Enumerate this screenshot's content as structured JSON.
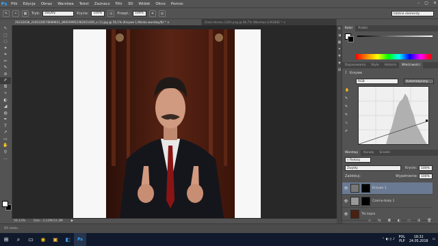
{
  "menubar": {
    "logo": "Ps",
    "items": [
      "Plik",
      "Edycja",
      "Obraz",
      "Warstwa",
      "Tekst",
      "Zaznacz",
      "Filtr",
      "3D",
      "Widok",
      "Okno",
      "Pomoc"
    ],
    "window_controls": [
      "–",
      "▢",
      "✕"
    ]
  },
  "options_bar": {
    "mode_label": "Tryb:",
    "mode_value": "Zwykły",
    "opacity_label": "Krycie:",
    "opacity_value": "100%",
    "flow_label": "Przepł.:",
    "flow_value": "100%",
    "workspace": "Istotne elementy"
  },
  "tabs": [
    {
      "label": "26232638_2045228578089831_869199952362811830_o (1).jpg @ 56,1% (Krzywe 1,Maska warstwy/8) *",
      "close": "×",
      "active": true
    },
    {
      "label": "Zrzut ekranu (120).png @ 66,7% (Warstwa 0,RGB/8) *",
      "close": "×",
      "active": false
    }
  ],
  "tools": [
    "↖",
    "⬚",
    "◌",
    "✦",
    "⌗",
    "✂",
    "✎",
    "⊘",
    "✐",
    "⧉",
    "✧",
    "◐",
    "◢",
    "◍",
    "✒",
    "T",
    "↗",
    "▭",
    "✋",
    "⚲",
    "…"
  ],
  "status": {
    "zoom": "56,13%",
    "doc": "Dok.: 3,12M/12,3M",
    "arrow": "▶"
  },
  "timeline": {
    "label": "Oś czasu"
  },
  "right_dock": {
    "color_tabs": [
      "Kolor",
      "Próbki"
    ],
    "props_tabs": [
      "Dopasowania",
      "Style",
      "Historia",
      "Właściwości"
    ],
    "props_title": "Krzywe",
    "preset_label": "RGB",
    "auto_label": "Automatyczny",
    "layers_tabs": [
      "Warstwy",
      "Kanały",
      "Ścieżki"
    ],
    "kind_label": "Rodzaj",
    "blend_value": "Zwykły",
    "opacity_label": "Krycie:",
    "opacity_value": "100%",
    "lock_label": "Zablokuj:",
    "fill_label": "Wypełnienie:",
    "fill_value": "100%",
    "layers": [
      {
        "name": "Krzywe 1",
        "selected": true
      },
      {
        "name": "Czarno-biały 1",
        "selected": false
      },
      {
        "name": "Tło kopia",
        "selected": false
      },
      {
        "name": "",
        "selected": false
      }
    ],
    "mini_buttons": [
      "≡",
      "◑",
      "▦",
      "✦",
      "❖",
      "◈",
      "▤"
    ]
  },
  "taskbar": {
    "icons": [
      "⊞",
      "⌕",
      "▭",
      "◉",
      "▣",
      "◧",
      "Ps"
    ],
    "tray_lang": "POL",
    "tray_lang2": "PLP",
    "time": "18:32",
    "date": "24.05.2018",
    "tray_icons": "⌃ ◐ ▯ ♪"
  },
  "colors": {
    "accent": "#31a8ff",
    "panel": "#535353",
    "canvas_bg": "#282828",
    "taskbar": "#101a2c",
    "layer_selected": "#6a7a92"
  }
}
